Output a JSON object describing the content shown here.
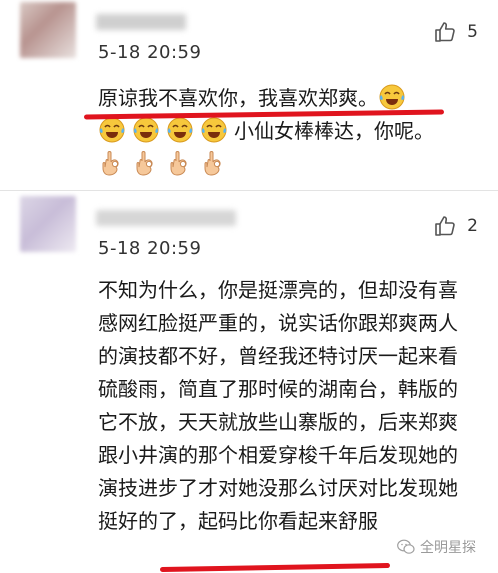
{
  "comments": [
    {
      "timestamp": "5-18 20:59",
      "like_count": "5",
      "text_line1": "原谅我不喜欢你，我喜欢郑爽。",
      "text_line2": "小仙女棒棒达，你呢。",
      "emoji_icons": [
        "tears-of-joy-emoji",
        "ok-hand-emoji"
      ]
    },
    {
      "timestamp": "5-18 20:59",
      "like_count": "2",
      "text": "不知为什么，你是挺漂亮的，但却没有喜感网红脸挺严重的，说实话你跟郑爽两人的演技都不好，曾经我还特讨厌一起来看硫酸雨，简直了那时候的湖南台，韩版的它不放，天天就放些山寨版的，后来郑爽跟小井演的那个相爱穿梭千年后发现她的演技进步了才对她没那么讨厌对比发现她挺好的了，起码比你看起来舒服"
    }
  ],
  "watermark": {
    "label": "全明星探",
    "icon": "wechat-icon"
  },
  "colors": {
    "highlight_underline": "#e0141e",
    "divider": "#e3e3e3"
  }
}
